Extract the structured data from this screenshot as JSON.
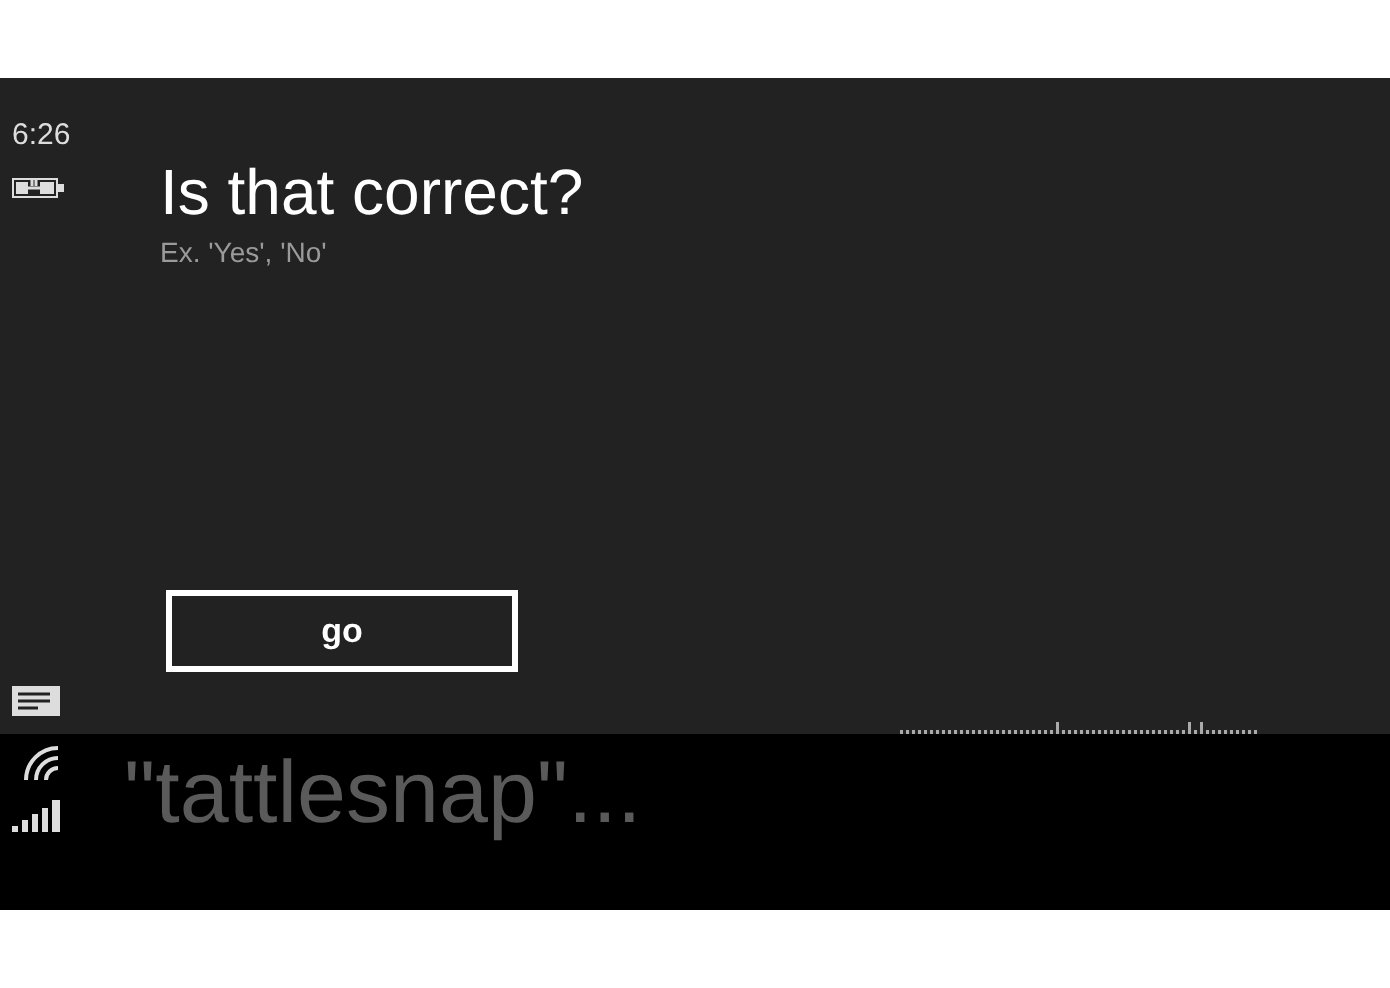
{
  "status_bar": {
    "time": "6:26"
  },
  "prompt": {
    "title": "Is that correct?",
    "hint": "Ex. 'Yes', 'No'"
  },
  "buttons": [
    {
      "label": "go"
    }
  ],
  "speech_panel": {
    "text": "\"tattlesnap\"..."
  }
}
